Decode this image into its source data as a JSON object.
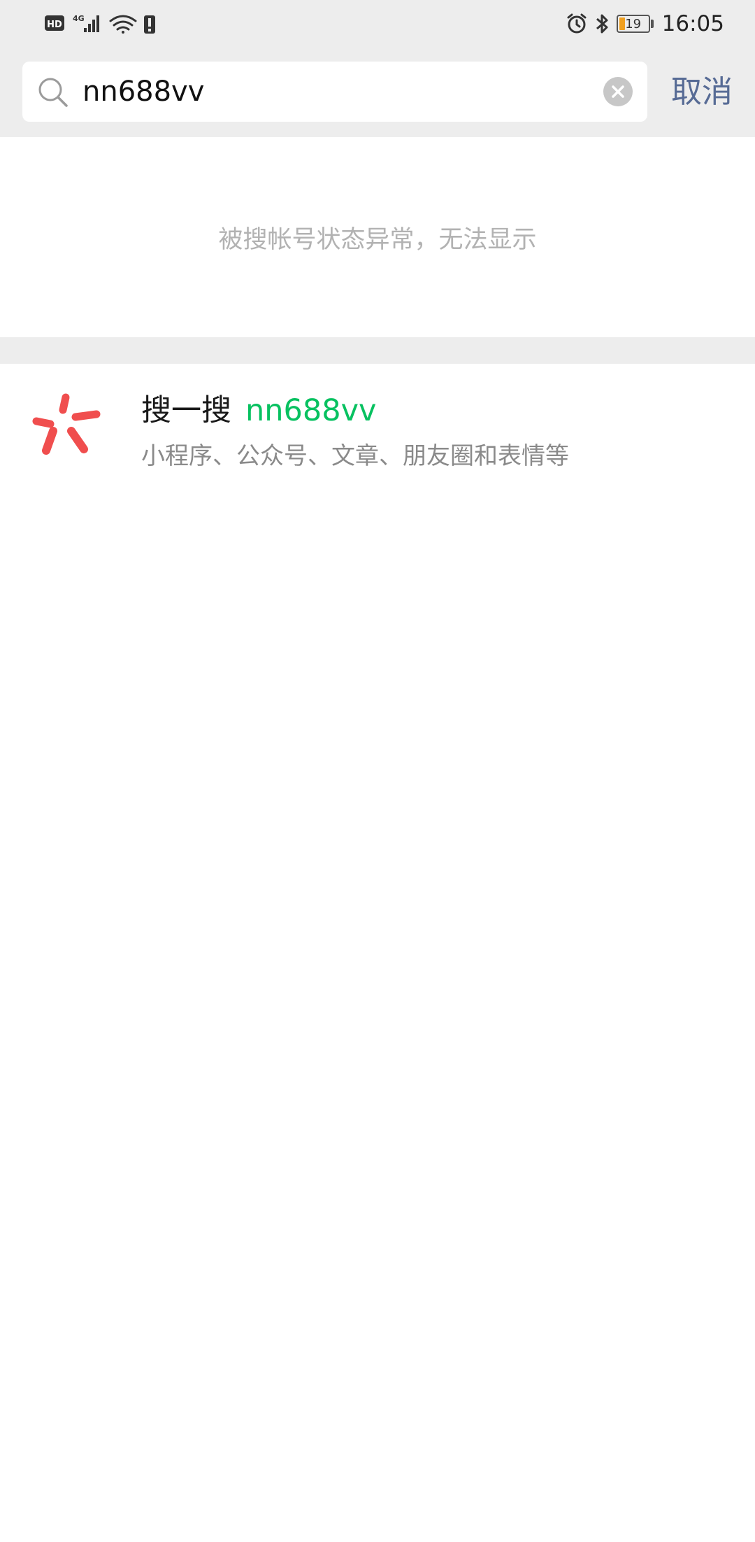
{
  "status_bar": {
    "network_label": "HD",
    "signal_label": "4G",
    "battery_level": "19",
    "time": "16:05"
  },
  "search": {
    "query": "nn688vv",
    "cancel_label": "取消"
  },
  "notice": {
    "text": "被搜帐号状态异常，无法显示"
  },
  "souyisou": {
    "title": "搜一搜",
    "keyword": "nn688vv",
    "subtitle": "小程序、公众号、文章、朋友圈和表情等"
  },
  "colors": {
    "accent_green": "#07c160",
    "link_blue": "#576b95",
    "souyisou_red": "#f04e4e",
    "background_gray": "#ededed"
  }
}
